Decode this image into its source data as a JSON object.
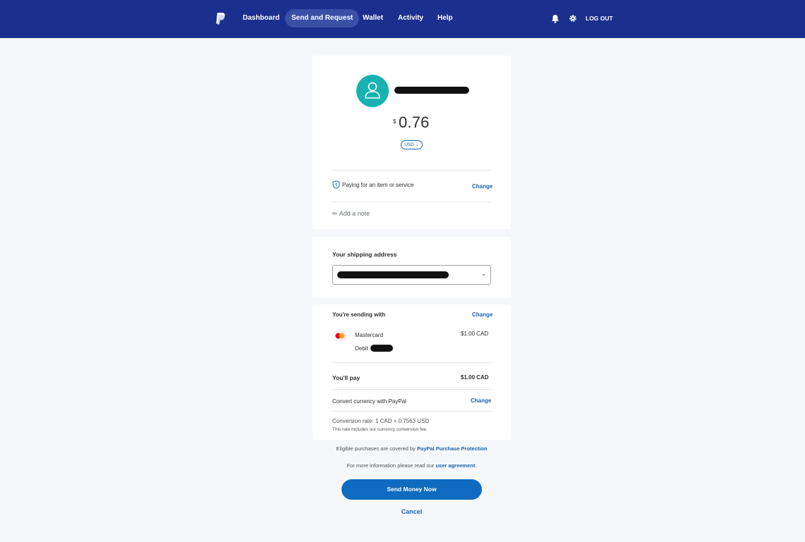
{
  "nav": {
    "items": [
      "Dashboard",
      "Send and Request",
      "Wallet",
      "Activity",
      "Help"
    ],
    "active_index": 1,
    "logout_label": "LOG OUT",
    "brand_color": "#1b2f8f"
  },
  "payment": {
    "currency_symbol": "$",
    "amount": "0.76",
    "currency_selector": "USD",
    "purpose_label": "Paying for an item or service",
    "purpose_change": "Change",
    "add_note": "Add a note"
  },
  "shipping": {
    "title": "Your shipping address"
  },
  "funding": {
    "title": "You're sending with",
    "change": "Change",
    "card_name": "Mastercard",
    "card_type": "Debit",
    "card_amount": "$1.00 CAD",
    "you_pay_label": "You'll pay",
    "you_pay_amount": "$1.00 CAD",
    "convert_label": "Convert currency with PayPal",
    "convert_change": "Change",
    "conversion_rate": "Conversion rate: 1 CAD = 0.7563 USD",
    "conversion_note": "This rate includes our currency conversion fee."
  },
  "footer": {
    "protection_prefix": "Eligible purchases are covered by",
    "protection_link": "PayPal Purchase Protection",
    "agreement_prefix": "For more information please read our",
    "agreement_link": "user agreement",
    "agreement_suffix": ".",
    "send_button": "Send Money Now",
    "cancel": "Cancel"
  },
  "colors": {
    "accent": "#1a65b0",
    "primary_button": "#0f6bbf",
    "avatar": "#17b2b0",
    "page_bg": "#f5f7fa"
  },
  "icons": [
    "paypal-logo-icon",
    "bell-icon",
    "gear-icon",
    "user-icon",
    "shield-icon",
    "pencil-icon",
    "chevron-down-icon",
    "mastercard-icon"
  ]
}
